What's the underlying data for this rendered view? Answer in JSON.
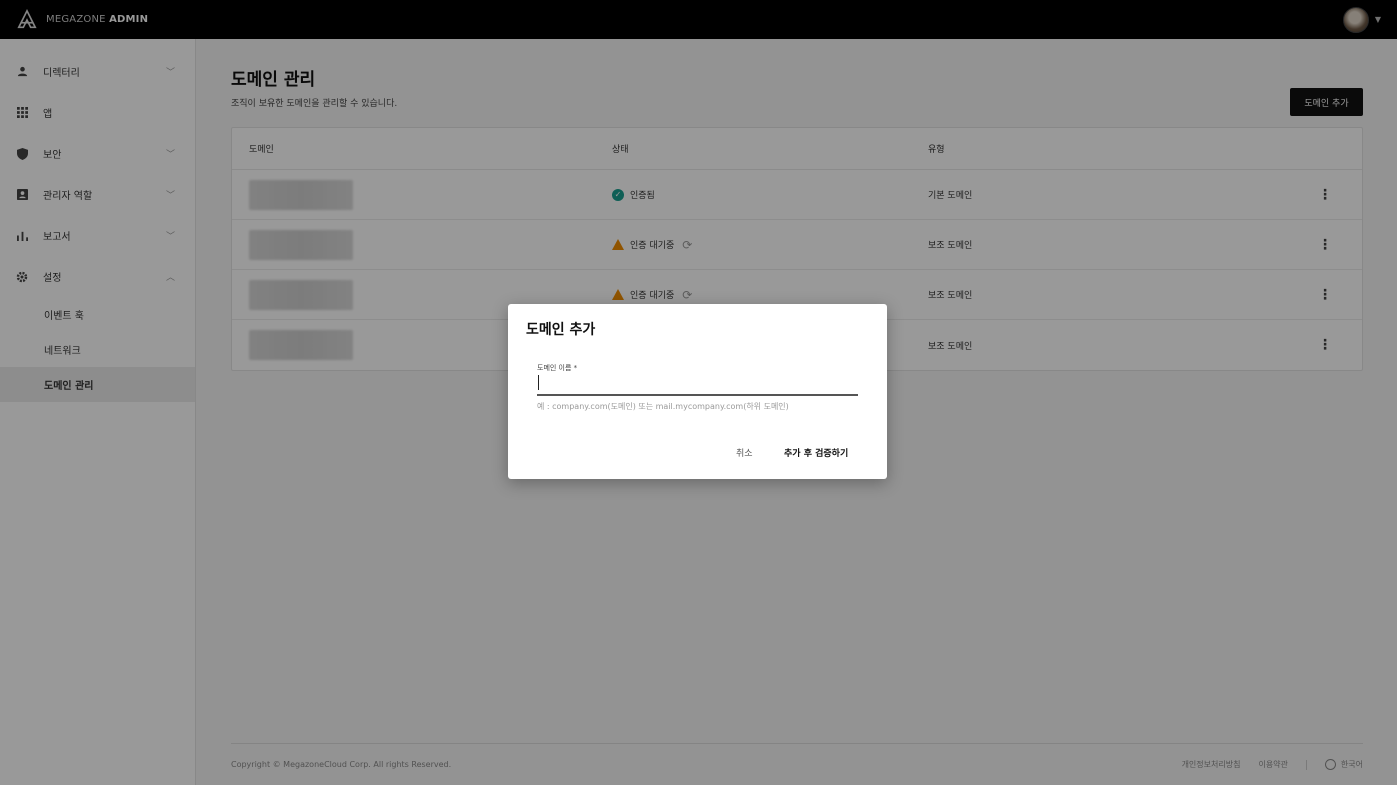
{
  "header": {
    "logo_light": "MEGAZONE",
    "logo_bold": "ADMIN",
    "logo_icon": "megazone-logo-icon",
    "avatar_icon": "user-avatar",
    "caret_icon": "caret-down-icon",
    "caret_glyph": "▼"
  },
  "sidebar": {
    "items": [
      {
        "label": "디렉터리",
        "icon": "person-icon",
        "glyph": "👤",
        "chevron": "﹀"
      },
      {
        "label": "앱",
        "icon": "apps-grid-icon",
        "glyph": "▦",
        "chevron": ""
      },
      {
        "label": "보안",
        "icon": "shield-icon",
        "glyph": "⛨",
        "chevron": "﹀"
      },
      {
        "label": "관리자 역할",
        "icon": "admin-badge-icon",
        "glyph": "▣",
        "chevron": "﹀"
      },
      {
        "label": "보고서",
        "icon": "bar-chart-icon",
        "glyph": "▮",
        "chevron": "﹀"
      },
      {
        "label": "설정",
        "icon": "gear-icon",
        "glyph": "⚙",
        "chevron": "︿"
      }
    ],
    "sub_items": [
      {
        "label": "이벤트 훅",
        "active": false
      },
      {
        "label": "네트워크",
        "active": false
      },
      {
        "label": "도메인 관리",
        "active": true
      }
    ]
  },
  "main": {
    "title": "도메인 관리",
    "description": "조직이 보유한 도메인을 관리할 수 있습니다.",
    "add_button": "도메인 추가",
    "table": {
      "headers": [
        "도메인",
        "상태",
        "유형"
      ],
      "rows": [
        {
          "status": "인증됨",
          "status_type": "verified",
          "type": "기본 도메인"
        },
        {
          "status": "인증 대기중",
          "status_type": "pending",
          "type": "보조 도메인"
        },
        {
          "status": "인증 대기중",
          "status_type": "pending",
          "type": "보조 도메인"
        },
        {
          "status": "",
          "status_type": "hidden",
          "type": "보조 도메인"
        }
      ],
      "more_glyph": "⋮",
      "refresh_glyph": "⟳",
      "check_glyph": "✓"
    }
  },
  "footer": {
    "copyright": "Copyright © MegazoneCloud Corp. All rights Reserved.",
    "privacy": "개인정보처리방침",
    "terms": "이용약관",
    "language": "한국어"
  },
  "dialog": {
    "title": "도메인 추가",
    "field_label": "도메인 이름 *",
    "field_value": "",
    "field_hint": "예 : company.com(도메인) 또는 mail.mycompany.com(하위 도메인)",
    "cancel": "취소",
    "confirm": "추가 후 검증하기"
  },
  "colors": {
    "topbar": "#000000",
    "verified": "#1a9e8f",
    "pending": "#f08c00",
    "primary_button": "#111111"
  }
}
